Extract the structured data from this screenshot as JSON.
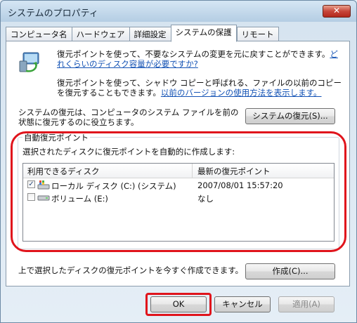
{
  "window": {
    "title": "システムのプロパティ",
    "close_label": "✕"
  },
  "tabs": [
    {
      "label": "コンピュータ名"
    },
    {
      "label": "ハードウェア"
    },
    {
      "label": "詳細設定"
    },
    {
      "label": "システムの保護"
    },
    {
      "label": "リモート"
    }
  ],
  "intro": {
    "p1_text": "復元ポイントを使って、不要なシステムの変更を元に戻すことができます。",
    "p1_link": "どれくらいのディスク容量が必要ですか?",
    "p2_text": "復元ポイントを使って、シャドウ コピーと呼ばれる、ファイルの以前のコピーを復元することもできます。",
    "p2_link": "以前のバージョンの使用方法を表示します。"
  },
  "restore": {
    "text": "システムの復元は、コンピュータのシステム ファイルを前の状態に復元するのに役立ちます。",
    "button": "システムの復元(S)..."
  },
  "auto_restore": {
    "group_label": "自動復元ポイント",
    "description": "選択されたディスクに復元ポイントを自動的に作成します:",
    "col_disk": "利用できるディスク",
    "col_latest": "最新の復元ポイント",
    "rows": [
      {
        "name": "ローカル ディスク (C:) (システム)",
        "latest": "2007/08/01 15:57:20",
        "checked": true
      },
      {
        "name": "ボリューム (E:)",
        "latest": "なし",
        "checked": false
      }
    ]
  },
  "create": {
    "text": "上で選択したディスクの復元ポイントを今すぐ作成できます。",
    "button": "作成(C)..."
  },
  "footer": {
    "ok": "OK",
    "cancel": "キャンセル",
    "apply": "適用(A)"
  },
  "colors": {
    "annotation": "#e0141c",
    "link": "#1453b5"
  }
}
